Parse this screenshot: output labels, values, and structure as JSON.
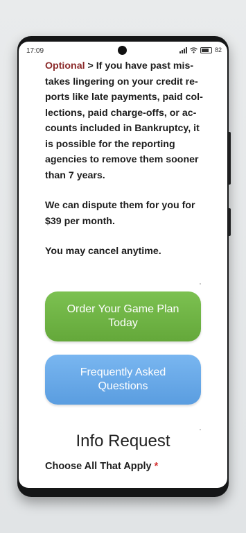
{
  "status_bar": {
    "time": "17:09",
    "battery": "82",
    "icons": [
      "signal-icon",
      "wifi-icon",
      "battery-icon"
    ]
  },
  "content": {
    "optional_label": "Optional",
    "paragraph1_lines": [
      " > If you have past mis-",
      "takes lingering on your credit re-",
      "ports like late payments, paid col-",
      "lections, paid charge-offs, or ac-",
      "counts included in Bankruptcy, it",
      "is possible for the reporting",
      "agencies to remove them sooner",
      "than 7 years."
    ],
    "paragraph2_lines": [
      "We can dispute them for you for",
      "$39 per month."
    ],
    "paragraph3": "You may cancel anytime."
  },
  "buttons": {
    "order_line1": "Order Your Game Plan",
    "order_line2": "Today",
    "faq_line1": "Frequently Asked",
    "faq_line2": "Questions"
  },
  "form": {
    "title": "Info Request",
    "choose_label": "Choose All That Apply",
    "required_mark": "*"
  },
  "colors": {
    "optional": "#8b2a2a",
    "green_button": "#6db244",
    "blue_button": "#6aaae8",
    "required": "#d32f2f"
  }
}
